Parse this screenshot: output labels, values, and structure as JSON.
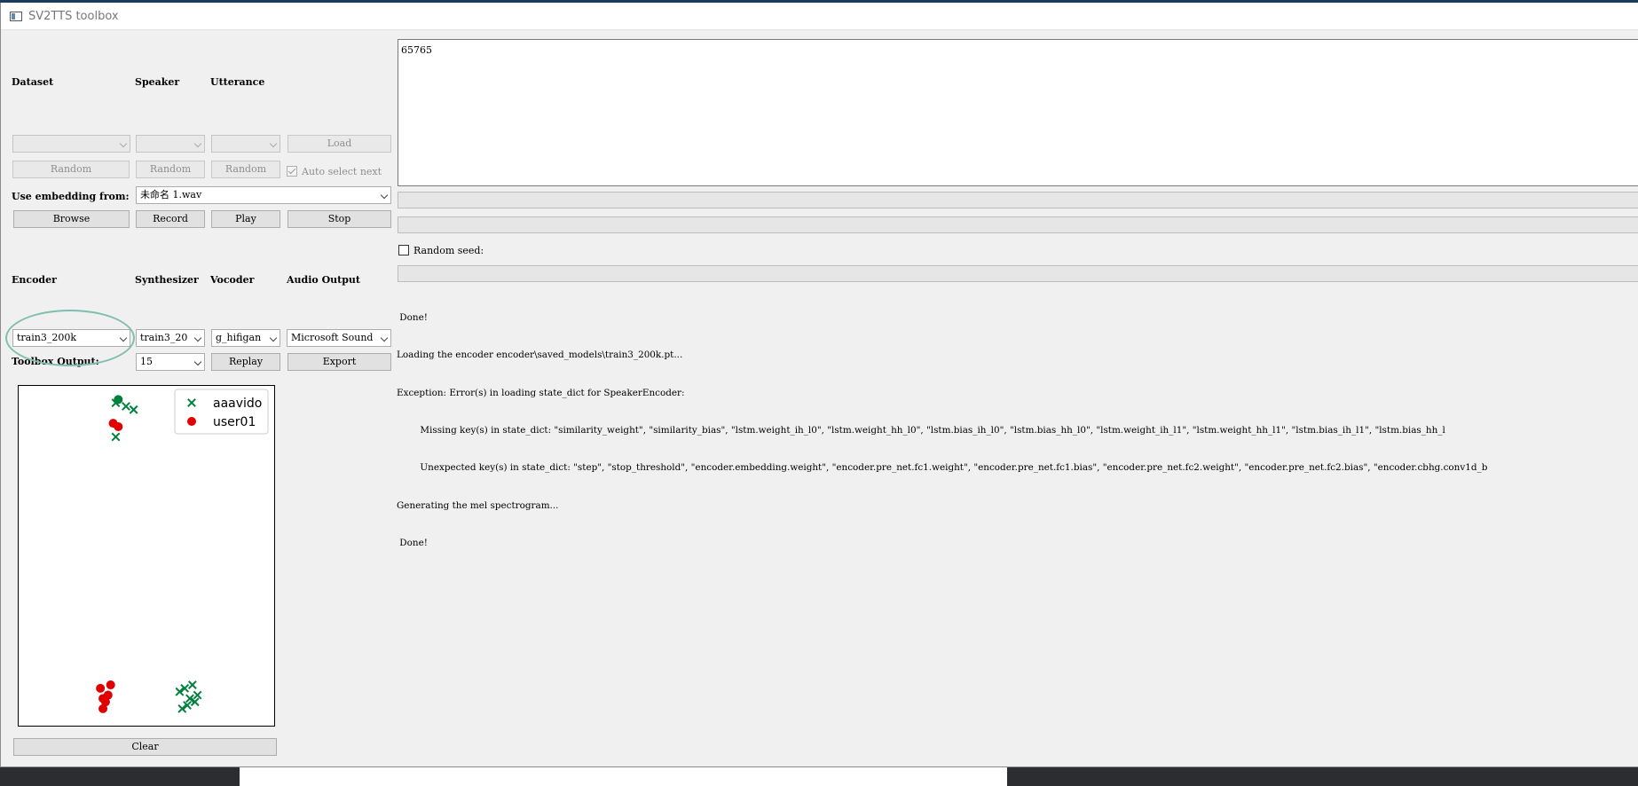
{
  "window": {
    "title": "SV2TTS toolbox"
  },
  "dataset_section": {
    "headers": {
      "dataset": "Dataset",
      "speaker": "Speaker",
      "utterance": "Utterance"
    },
    "dataset_value": "",
    "speaker_value": "",
    "utterance_value": "",
    "load_label": "Load",
    "random_dataset_label": "Random",
    "random_speaker_label": "Random",
    "random_utterance_label": "Random",
    "auto_select_label": "Auto select next",
    "auto_select_checked": true
  },
  "embedding": {
    "label": "Use embedding from:",
    "value": "未命名 1.wav",
    "browse_label": "Browse",
    "record_label": "Record",
    "play_label": "Play",
    "stop_label": "Stop"
  },
  "models": {
    "headers": {
      "encoder": "Encoder",
      "synthesizer": "Synthesizer",
      "vocoder": "Vocoder",
      "audio_output": "Audio Output"
    },
    "encoder_value": "train3_200k",
    "synthesizer_value": "train3_20",
    "vocoder_value": "g_hifigan",
    "audio_output_value": "Microsoft Sound"
  },
  "toolbox_output": {
    "label": "Toolbox Output:",
    "value": "15",
    "replay_label": "Replay",
    "export_label": "Export"
  },
  "text_input": {
    "value": "65765"
  },
  "random_seed": {
    "label": "Random seed:",
    "checked": false
  },
  "log_lines": [
    " Done!",
    "Loading the encoder encoder\\saved_models\\train3_200k.pt...",
    "Exception: Error(s) in loading state_dict for SpeakerEncoder:",
    "        Missing key(s) in state_dict: \"similarity_weight\", \"similarity_bias\", \"lstm.weight_ih_l0\", \"lstm.weight_hh_l0\", \"lstm.bias_ih_l0\", \"lstm.bias_hh_l0\", \"lstm.weight_ih_l1\", \"lstm.weight_hh_l1\", \"lstm.bias_ih_l1\", \"lstm.bias_hh_l",
    "        Unexpected key(s) in state_dict: \"step\", \"stop_threshold\", \"encoder.embedding.weight\", \"encoder.pre_net.fc1.weight\", \"encoder.pre_net.fc1.bias\", \"encoder.pre_net.fc2.weight\", \"encoder.pre_net.fc2.bias\", \"encoder.cbhg.conv1d_b",
    "Generating the mel spectrogram...",
    " Done!"
  ],
  "clear_label": "Clear",
  "colors": {
    "aaavido": "#00803c",
    "user01": "#e00000",
    "annotation": "#7fbfae"
  },
  "chart_data": {
    "type": "scatter",
    "grid": false,
    "legend": "top-right",
    "xlim": [
      0,
      1
    ],
    "ylim": [
      0,
      1
    ],
    "series": [
      {
        "name": "aaavido",
        "marker": "x",
        "color": "#00803c",
        "points": [
          [
            0.38,
            0.95
          ],
          [
            0.42,
            0.94
          ],
          [
            0.45,
            0.93
          ],
          [
            0.38,
            0.85
          ],
          [
            0.63,
            0.1
          ],
          [
            0.67,
            0.08
          ],
          [
            0.65,
            0.11
          ],
          [
            0.69,
            0.07
          ],
          [
            0.66,
            0.06
          ],
          [
            0.7,
            0.09
          ],
          [
            0.68,
            0.12
          ],
          [
            0.64,
            0.05
          ]
        ]
      },
      {
        "name": "user01",
        "marker": "o",
        "color": "#e00000",
        "points": [
          [
            0.37,
            0.89
          ],
          [
            0.39,
            0.88
          ],
          [
            0.32,
            0.11
          ],
          [
            0.33,
            0.08
          ],
          [
            0.35,
            0.09
          ],
          [
            0.33,
            0.05
          ],
          [
            0.34,
            0.07
          ],
          [
            0.36,
            0.12
          ]
        ]
      },
      {
        "name": "aaavido",
        "marker": "o",
        "color": "#00803c",
        "points": [
          [
            0.39,
            0.96
          ]
        ]
      }
    ]
  }
}
